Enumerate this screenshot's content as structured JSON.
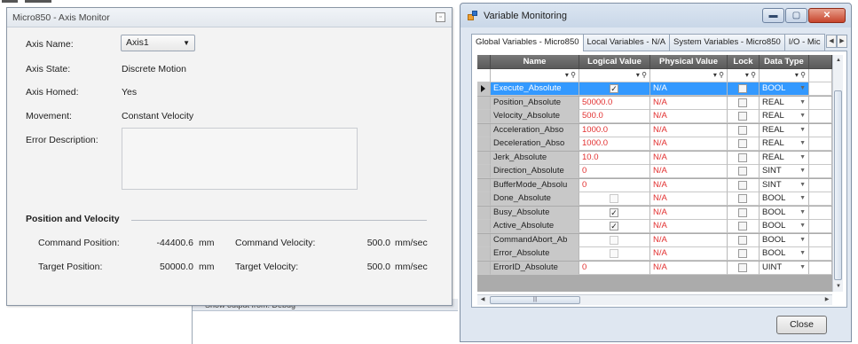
{
  "axis_monitor": {
    "title": "Micro850 - Axis Monitor",
    "axis_name_label": "Axis Name:",
    "axis_name_value": "Axis1",
    "axis_state_label": "Axis State:",
    "axis_state_value": "Discrete Motion",
    "axis_homed_label": "Axis Homed:",
    "axis_homed_value": "Yes",
    "movement_label": "Movement:",
    "movement_value": "Constant Velocity",
    "error_description_label": "Error Description:",
    "section_title": "Position and Velocity",
    "command_position_label": "Command Position:",
    "command_position_value": "-44400.6",
    "command_position_unit": "mm",
    "target_position_label": "Target Position:",
    "target_position_value": "50000.0",
    "target_position_unit": "mm",
    "command_velocity_label": "Command Velocity:",
    "command_velocity_value": "500.0",
    "command_velocity_unit": "mm/sec",
    "target_velocity_label": "Target Velocity:",
    "target_velocity_value": "500.0",
    "target_velocity_unit": "mm/sec"
  },
  "background": {
    "output_bar_text": "Show output from:  Debug"
  },
  "variable_monitoring": {
    "title": "Variable Monitoring",
    "tabs": [
      "Global Variables - Micro850",
      "Local Variables - N/A",
      "System Variables - Micro850",
      "I/O - Mic"
    ],
    "columns": {
      "name": "Name",
      "logical_value": "Logical Value",
      "physical_value": "Physical Value",
      "lock": "Lock",
      "data_type": "Data Type"
    },
    "rows": [
      {
        "name": "Execute_Absolute",
        "logical": "",
        "logical_checkbox": "checked",
        "physical": "N/A",
        "type": "BOOL"
      },
      {
        "name": "Position_Absolute",
        "logical": "50000.0",
        "logical_checkbox": "none",
        "physical": "N/A",
        "type": "REAL"
      },
      {
        "name": "Velocity_Absolute",
        "logical": "500.0",
        "logical_checkbox": "none",
        "physical": "N/A",
        "type": "REAL"
      },
      {
        "name": "Acceleration_Abso",
        "logical": "1000.0",
        "logical_checkbox": "none",
        "physical": "N/A",
        "type": "REAL"
      },
      {
        "name": "Deceleration_Abso",
        "logical": "1000.0",
        "logical_checkbox": "none",
        "physical": "N/A",
        "type": "REAL"
      },
      {
        "name": "Jerk_Absolute",
        "logical": "10.0",
        "logical_checkbox": "none",
        "physical": "N/A",
        "type": "REAL"
      },
      {
        "name": "Direction_Absolute",
        "logical": "0",
        "logical_checkbox": "none",
        "physical": "N/A",
        "type": "SINT"
      },
      {
        "name": "BufferMode_Absolu",
        "logical": "0",
        "logical_checkbox": "none",
        "physical": "N/A",
        "type": "SINT"
      },
      {
        "name": "Done_Absolute",
        "logical": "",
        "logical_checkbox": "dim",
        "physical": "N/A",
        "type": "BOOL"
      },
      {
        "name": "Busy_Absolute",
        "logical": "",
        "logical_checkbox": "checked",
        "physical": "N/A",
        "type": "BOOL"
      },
      {
        "name": "Active_Absolute",
        "logical": "",
        "logical_checkbox": "checked",
        "physical": "N/A",
        "type": "BOOL"
      },
      {
        "name": "CommandAbort_Ab",
        "logical": "",
        "logical_checkbox": "dim",
        "physical": "N/A",
        "type": "BOOL"
      },
      {
        "name": "Error_Absolute",
        "logical": "",
        "logical_checkbox": "dim",
        "physical": "N/A",
        "type": "BOOL"
      },
      {
        "name": "ErrorID_Absolute",
        "logical": "0",
        "logical_checkbox": "none",
        "physical": "N/A",
        "type": "UINT"
      }
    ],
    "close_label": "Close",
    "selected_row": 0,
    "colors": {
      "value_red": "#e23030",
      "selection": "#3399ff",
      "header": "#5a5a5a"
    }
  }
}
